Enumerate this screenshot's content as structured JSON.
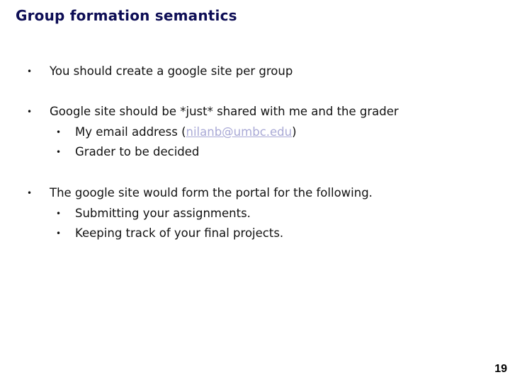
{
  "slide": {
    "title": "Group formation semantics",
    "page_number": "19",
    "bullets": [
      {
        "text": "You should create a google site per group",
        "sub": []
      },
      {
        "text": "Google site should be *just* shared with me and the grader",
        "sub": [
          {
            "prefix": "My email address (",
            "link": "nilanb@umbc.edu",
            "suffix": ")"
          },
          {
            "text": "Grader to be decided"
          }
        ]
      },
      {
        "text": "The google site would form the portal for the following.",
        "sub": [
          {
            "text": "Submitting your assignments."
          },
          {
            "text": "Keeping track of your final projects."
          }
        ]
      }
    ],
    "bullet_glyph": "•",
    "colors": {
      "title": "#0d0d55",
      "body_text": "#111111",
      "link": "#a9a9d6"
    }
  }
}
